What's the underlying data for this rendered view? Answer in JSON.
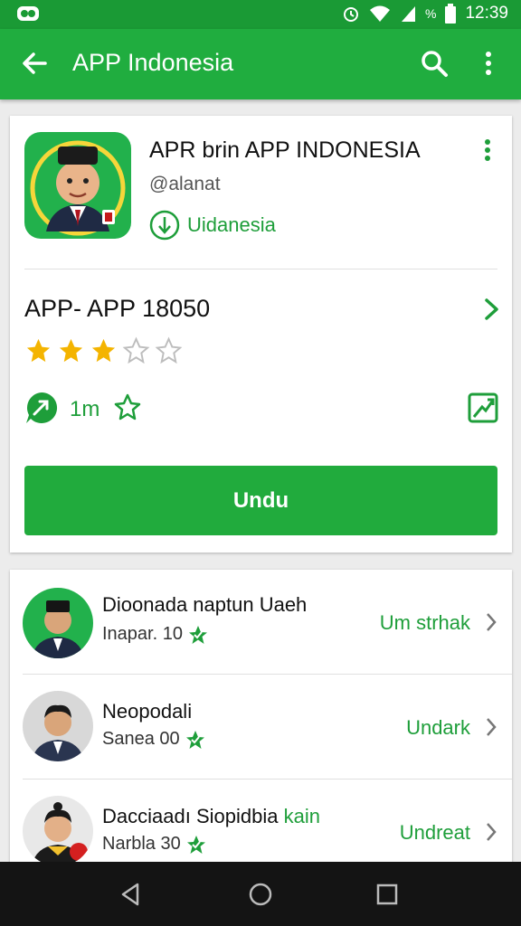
{
  "status": {
    "time": "12:39",
    "battery_text": "%"
  },
  "appbar": {
    "title": "APP Indonesia"
  },
  "app": {
    "name": "APR brin APP INDONESIA",
    "developer": "@alanat",
    "tag": "Uidanesia",
    "subtitle": "APP- APP 18050",
    "rating": 3,
    "rating_max": 5,
    "count": "1m",
    "install_label": "Undu"
  },
  "list": [
    {
      "name": "Dioonada naptun Uaeh",
      "name_extra": "",
      "meta": "Inapar. 10",
      "action": "Um strhak"
    },
    {
      "name": "Neopodali",
      "name_extra": "",
      "meta": "Sanea 00",
      "action": "Undark"
    },
    {
      "name": "Dacciaadı Siopidbia",
      "name_extra": "kain",
      "meta": "Narbla 30",
      "action": "Undreat"
    }
  ],
  "colors": {
    "primary": "#20ad3f",
    "status_bar": "#1a9a35",
    "accent_text": "#1e9e3a",
    "star_filled": "#f4b400",
    "nav_bar": "#141414"
  }
}
